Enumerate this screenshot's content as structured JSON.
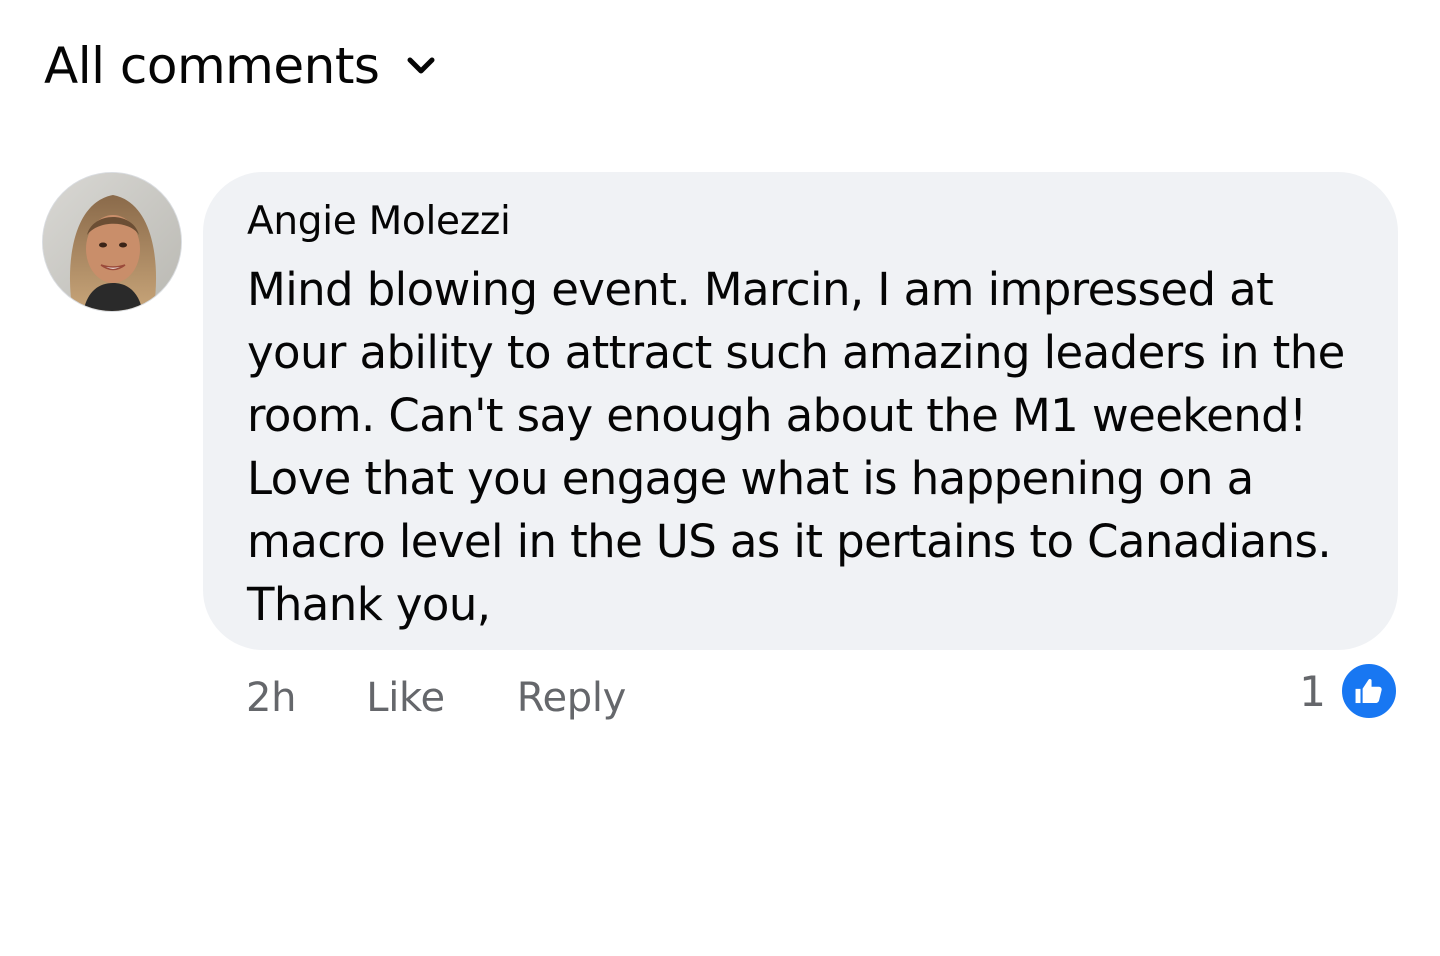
{
  "sort": {
    "label": "All comments",
    "icon": "chevron-down-icon"
  },
  "comment": {
    "author": "Angie Molezzi",
    "text_lines": [
      "Mind blowing event. Marcin, I am impressed at",
      "your ability to attract such amazing leaders in the",
      "room. Can't say enough about the M1 weekend!",
      "Love that you engage what is happening on a",
      "macro level in the US as it pertains to Canadians.",
      "Thank you,"
    ],
    "time": "2h",
    "like_label": "Like",
    "reply_label": "Reply",
    "reaction_count": "1",
    "reaction_icon": "thumbs-up-icon"
  },
  "colors": {
    "bubble_bg": "#f0f2f5",
    "meta_text": "#65676b",
    "like_blue": "#1877f2"
  }
}
